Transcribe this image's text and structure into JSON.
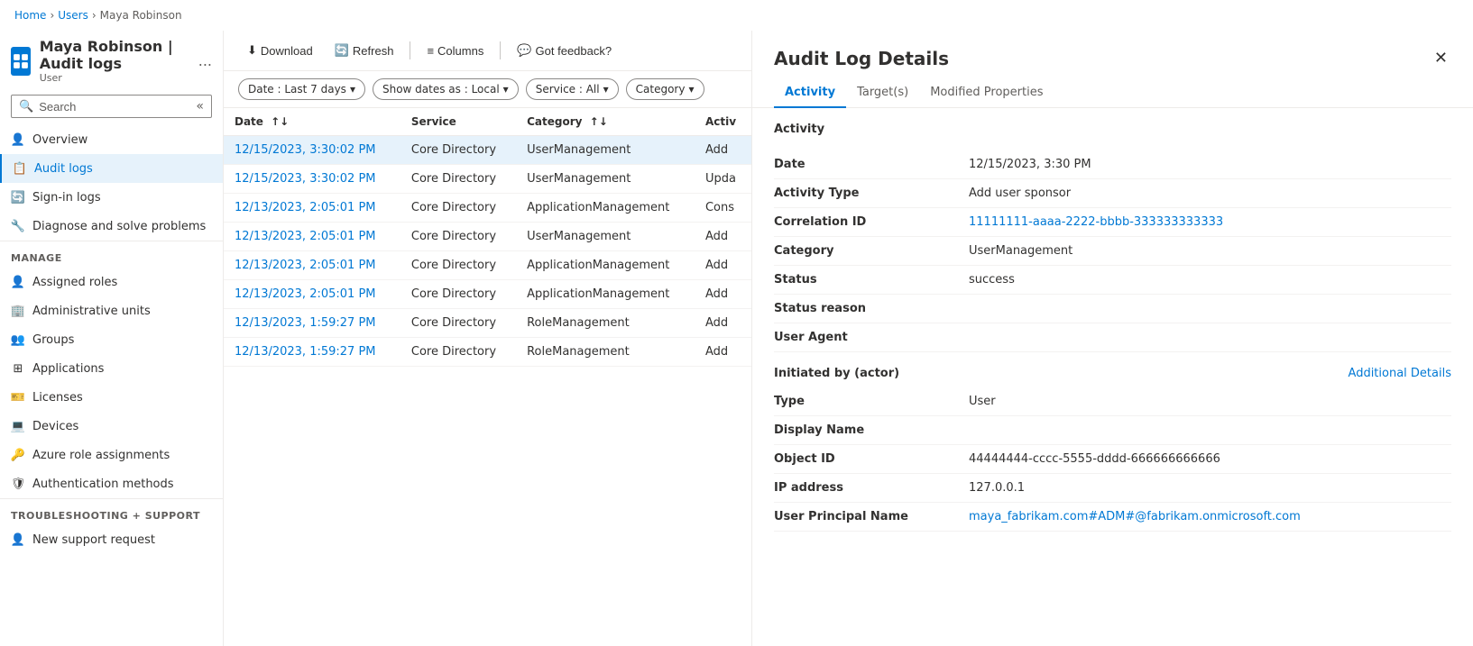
{
  "breadcrumb": {
    "items": [
      "Home",
      "Users",
      "Maya Robinson"
    ]
  },
  "sidebar": {
    "title": "Maya Robinson",
    "title_full": "Maya Robinson | Audit logs",
    "subtitle": "User",
    "ellipsis": "...",
    "search_placeholder": "Search",
    "collapse_tooltip": "Collapse",
    "nav_items": [
      {
        "id": "overview",
        "label": "Overview",
        "icon": "person"
      },
      {
        "id": "audit-logs",
        "label": "Audit logs",
        "icon": "audit",
        "active": true
      },
      {
        "id": "sign-in-logs",
        "label": "Sign-in logs",
        "icon": "signin"
      },
      {
        "id": "diagnose",
        "label": "Diagnose and solve problems",
        "icon": "wrench"
      }
    ],
    "manage_label": "Manage",
    "manage_items": [
      {
        "id": "assigned-roles",
        "label": "Assigned roles",
        "icon": "role"
      },
      {
        "id": "admin-units",
        "label": "Administrative units",
        "icon": "admin"
      },
      {
        "id": "groups",
        "label": "Groups",
        "icon": "groups"
      },
      {
        "id": "applications",
        "label": "Applications",
        "icon": "apps"
      },
      {
        "id": "licenses",
        "label": "Licenses",
        "icon": "license"
      },
      {
        "id": "devices",
        "label": "Devices",
        "icon": "devices"
      },
      {
        "id": "azure-roles",
        "label": "Azure role assignments",
        "icon": "key"
      },
      {
        "id": "auth-methods",
        "label": "Authentication methods",
        "icon": "shield"
      }
    ],
    "support_label": "Troubleshooting + Support",
    "support_items": [
      {
        "id": "new-support",
        "label": "New support request",
        "icon": "support"
      }
    ]
  },
  "toolbar": {
    "download_label": "Download",
    "refresh_label": "Refresh",
    "columns_label": "Columns",
    "feedback_label": "Got feedback?"
  },
  "filters": {
    "date": "Date : Last 7 days",
    "show_dates": "Show dates as : Local",
    "service": "Service : All",
    "category": "Category"
  },
  "table": {
    "columns": [
      "Date",
      "Service",
      "Category",
      "Activ"
    ],
    "rows": [
      {
        "date": "12/15/2023, 3:30:02 PM",
        "service": "Core Directory",
        "category": "UserManagement",
        "activity": "Add"
      },
      {
        "date": "12/15/2023, 3:30:02 PM",
        "service": "Core Directory",
        "category": "UserManagement",
        "activity": "Upda"
      },
      {
        "date": "12/13/2023, 2:05:01 PM",
        "service": "Core Directory",
        "category": "ApplicationManagement",
        "activity": "Cons"
      },
      {
        "date": "12/13/2023, 2:05:01 PM",
        "service": "Core Directory",
        "category": "UserManagement",
        "activity": "Add"
      },
      {
        "date": "12/13/2023, 2:05:01 PM",
        "service": "Core Directory",
        "category": "ApplicationManagement",
        "activity": "Add"
      },
      {
        "date": "12/13/2023, 2:05:01 PM",
        "service": "Core Directory",
        "category": "ApplicationManagement",
        "activity": "Add"
      },
      {
        "date": "12/13/2023, 1:59:27 PM",
        "service": "Core Directory",
        "category": "RoleManagement",
        "activity": "Add"
      },
      {
        "date": "12/13/2023, 1:59:27 PM",
        "service": "Core Directory",
        "category": "RoleManagement",
        "activity": "Add"
      }
    ]
  },
  "panel": {
    "title": "Audit Log Details",
    "tabs": [
      "Activity",
      "Target(s)",
      "Modified Properties"
    ],
    "active_tab": "Activity",
    "section_title": "Activity",
    "details": [
      {
        "label": "Date",
        "value": "12/15/2023, 3:30 PM",
        "link": false
      },
      {
        "label": "Activity Type",
        "value": "Add user sponsor",
        "link": false
      },
      {
        "label": "Correlation ID",
        "value": "11111111-aaaa-2222-bbbb-333333333333",
        "link": false
      },
      {
        "label": "Category",
        "value": "UserManagement",
        "link": false
      },
      {
        "label": "Status",
        "value": "success",
        "link": false
      },
      {
        "label": "Status reason",
        "value": "",
        "link": false
      },
      {
        "label": "User Agent",
        "value": "",
        "link": false
      }
    ],
    "actor_section": "Initiated by (actor)",
    "additional_details_label": "Additional Details",
    "actor_details": [
      {
        "label": "Type",
        "value": "User",
        "link": false
      },
      {
        "label": "Display Name",
        "value": "",
        "link": false
      },
      {
        "label": "Object ID",
        "value": "44444444-cccc-5555-dddd-666666666666",
        "link": false
      },
      {
        "label": "IP address",
        "value": "127.0.0.1",
        "link": false
      },
      {
        "label": "User Principal Name",
        "value": "maya_fabrikam.com#ADM#@fabrikam.onmicrosoft.com",
        "link": true
      }
    ]
  }
}
